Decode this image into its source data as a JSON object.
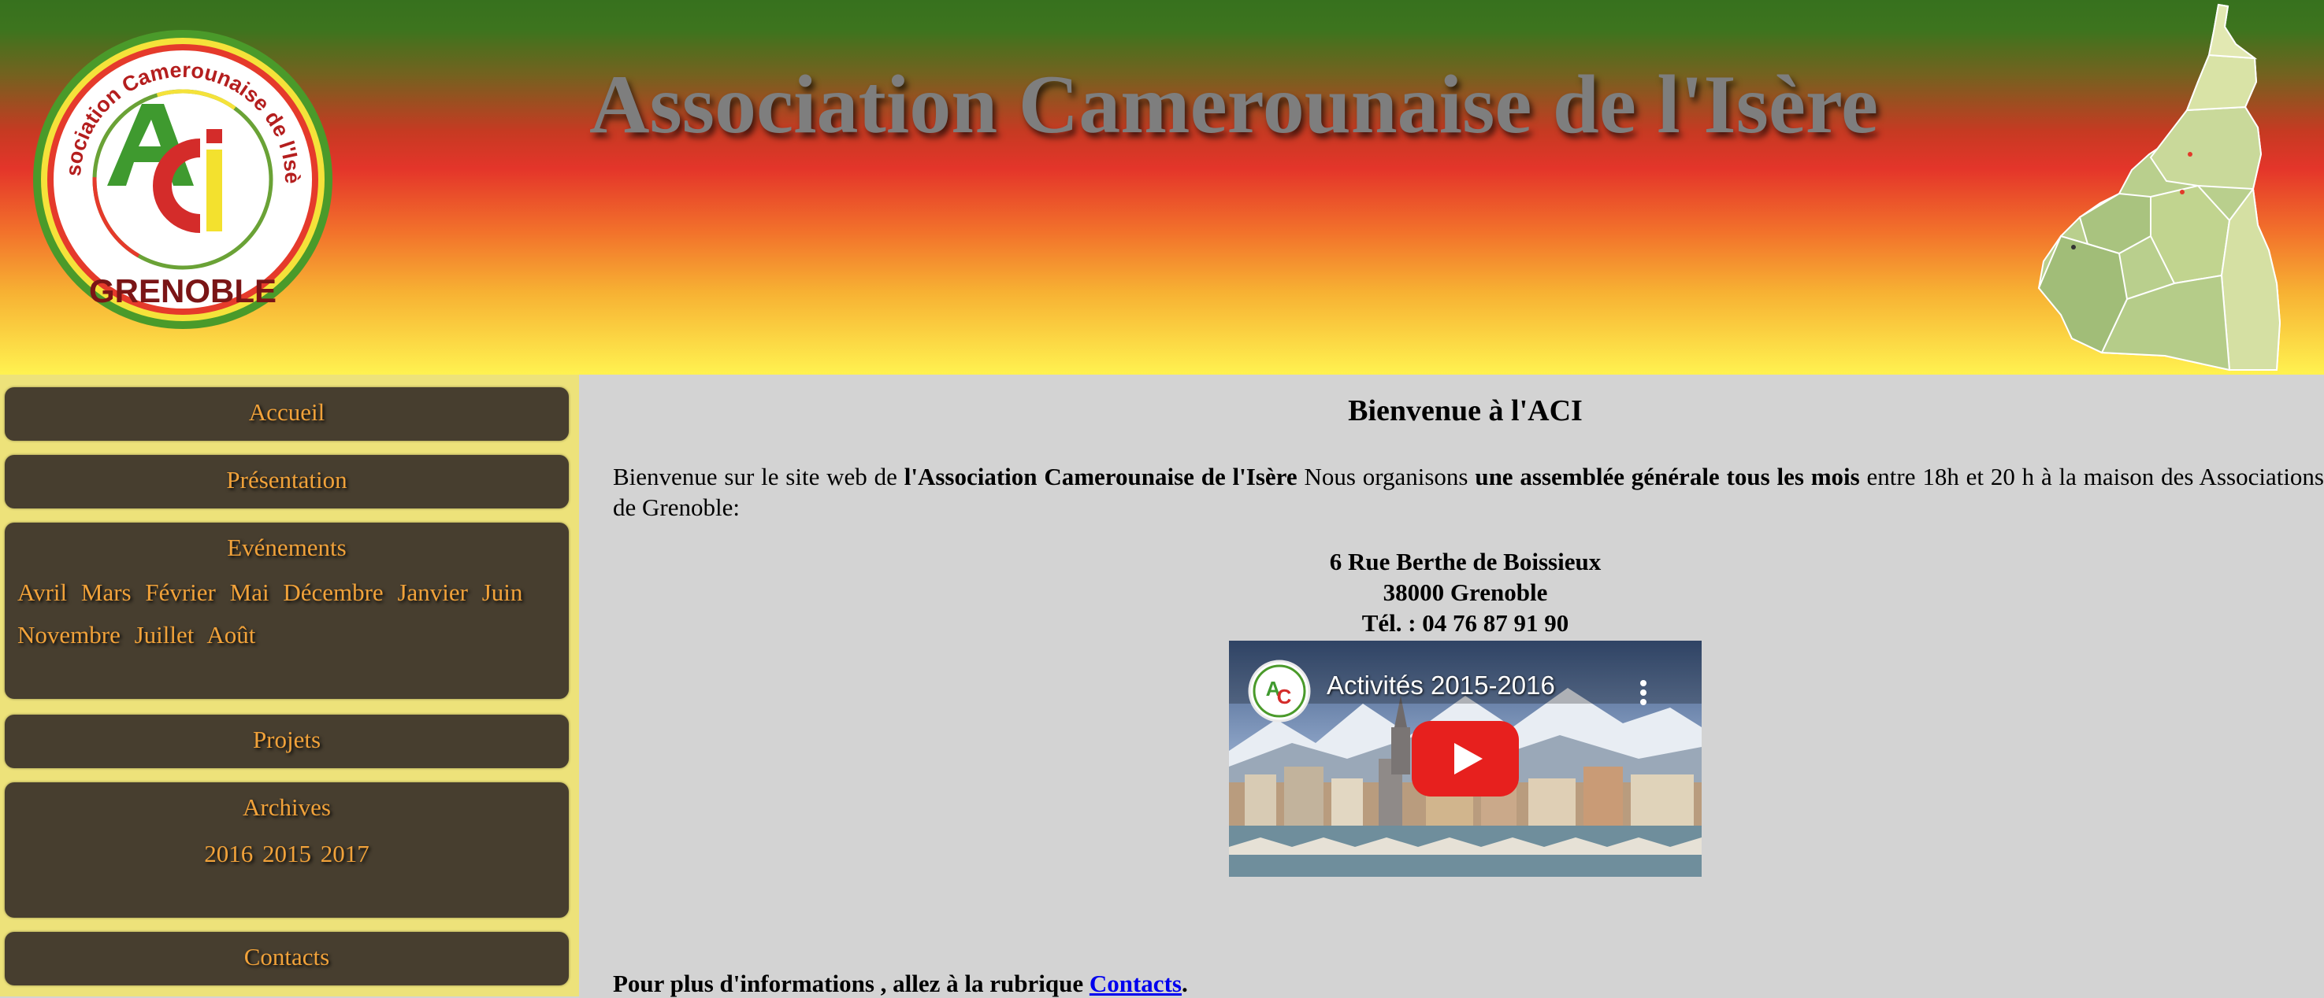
{
  "header": {
    "title": "Association Camerounaise de l'Isère",
    "logo": {
      "arc_text": "Association Camerounaise de l'Isère",
      "monogram": "ACI",
      "city": "GRENOBLE"
    },
    "map_regions": [
      "Extrême-Nord",
      "Nord",
      "Adamaoua",
      "Nord-Ouest",
      "Ouest",
      "Littoral",
      "Centre",
      "Sud-Ouest",
      "Est",
      "Sud"
    ]
  },
  "sidebar": {
    "accueil": "Accueil",
    "presentation": "Présentation",
    "evenements": {
      "label": "Evénements",
      "months": [
        "Avril",
        "Mars",
        "Février",
        "Mai",
        "Décembre",
        "Janvier",
        "Juin",
        "Novembre",
        "Juillet",
        "Août"
      ]
    },
    "projets": "Projets",
    "archives": {
      "label": "Archives",
      "years": [
        "2016",
        "2015",
        "2017"
      ]
    },
    "contacts": "Contacts"
  },
  "main": {
    "heading": "Bienvenue à l'ACI",
    "intro": {
      "part1": "Bienvenue sur le site web de ",
      "org": "l'Association Camerounaise de l'Isère",
      "part2": " Nous organisons ",
      "meeting": "une assemblée générale tous les mois",
      "part3": " entre 18h et 20 h à la maison des Associations de Grenoble:"
    },
    "address": {
      "street": "6 Rue Berthe de Boissieux",
      "city": "38000 Grenoble",
      "phone": "Tél. : 04 76 87 91 90"
    },
    "video": {
      "title": "Activités 2015-2016"
    },
    "more_info": {
      "text": "Pour plus d'informations , allez à la rubrique ",
      "link": "Contacts",
      "end": "."
    }
  },
  "colors": {
    "menu_bg": "#473e2f",
    "menu_text": "#f1a23a",
    "sidebar_bg": "#ede27a",
    "content_bg": "#d3d3d3",
    "link": "#0000ee"
  }
}
